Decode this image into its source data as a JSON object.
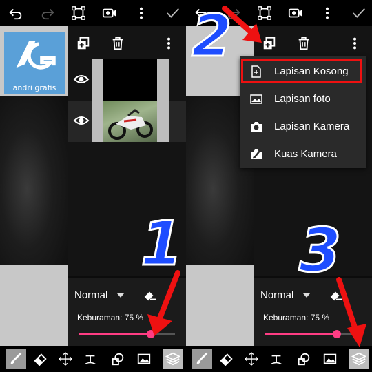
{
  "left_panel": {
    "logo": {
      "text": "andri grafis"
    },
    "blend_mode": "Normal",
    "opacity_label": "Keburaman: 75 %",
    "opacity_value": 0.75,
    "step_number": "1"
  },
  "right_panel": {
    "blend_mode": "Normal",
    "opacity_label": "Keburaman: 75 %",
    "opacity_value": 0.75,
    "step_number_top": "2",
    "step_number_bottom": "3",
    "add_layer_menu": {
      "items": [
        {
          "label": "Lapisan Kosong",
          "icon": "blank-layer-icon",
          "highlighted": true
        },
        {
          "label": "Lapisan foto",
          "icon": "photo-layer-icon"
        },
        {
          "label": "Lapisan Kamera",
          "icon": "camera-layer-icon"
        },
        {
          "label": "Kuas Kamera",
          "icon": "camera-brush-icon"
        }
      ]
    }
  },
  "colors": {
    "accent": "#ff3d84",
    "highlight_border": "#e11111",
    "step_number": "#1e4dff",
    "arrow": "#e11111"
  }
}
